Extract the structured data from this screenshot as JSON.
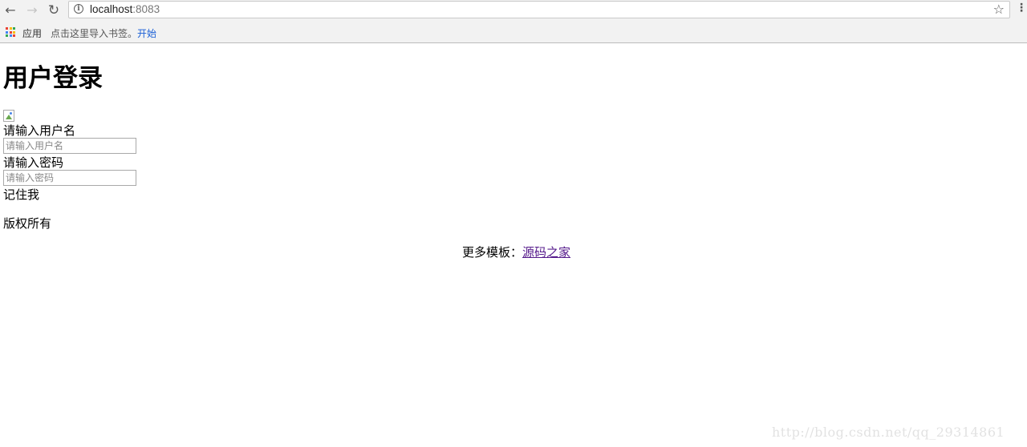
{
  "browser": {
    "url_host": "localhost",
    "url_port": ":8083",
    "bookmarks": {
      "apps_label": "应用",
      "import_hint": "点击这里导入书签。",
      "start_label": "开始"
    },
    "icons": {
      "back": "back-arrow-icon",
      "forward": "forward-arrow-icon",
      "reload": "reload-icon",
      "info": "info-icon",
      "star": "star-icon",
      "menu": "menu-icon",
      "apps": "apps-grid-icon"
    }
  },
  "page": {
    "title": "用户登录",
    "username_label": "请输入用户名",
    "username_placeholder": "请输入用户名",
    "username_value": "",
    "password_label": "请输入密码",
    "password_placeholder": "请输入密码",
    "password_value": "",
    "remember_label": "记住我",
    "copyright": "版权所有",
    "more_templates_prefix": "更多模板：",
    "more_templates_link": "源码之家"
  },
  "watermark": "http://blog.csdn.net/qq_29314861"
}
